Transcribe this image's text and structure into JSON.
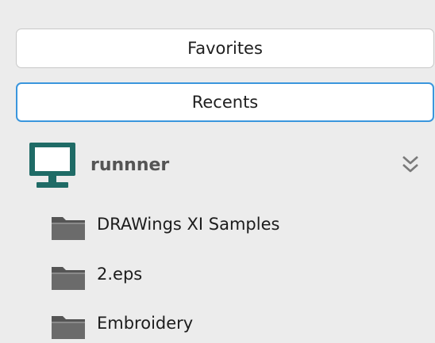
{
  "buttons": {
    "favorites_label": "Favorites",
    "recents_label": "Recents"
  },
  "device": {
    "name": "runnner",
    "icon": "monitor-icon",
    "toggle_icon": "double-chevron-down-icon"
  },
  "folders": [
    {
      "label": "DRAWings XI Samples",
      "icon": "folder-icon"
    },
    {
      "label": "2.eps",
      "icon": "folder-icon"
    },
    {
      "label": "Embroidery",
      "icon": "folder-icon"
    }
  ],
  "colors": {
    "background": "#ececec",
    "selected_border": "#3a96dd",
    "monitor": "#1f6b66",
    "folder": "#686868"
  }
}
